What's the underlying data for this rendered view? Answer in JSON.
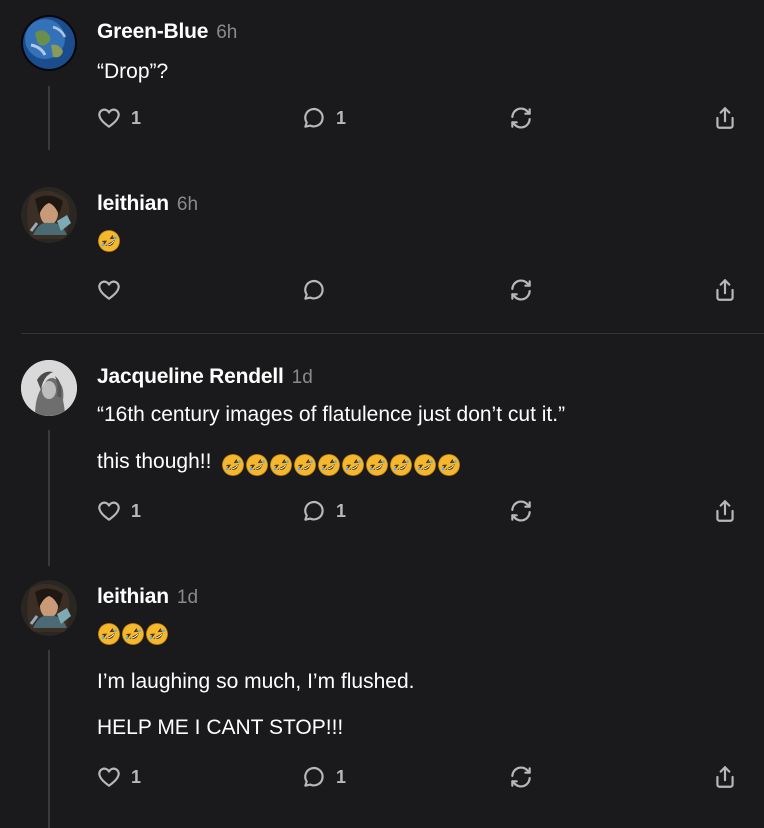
{
  "comments": [
    {
      "author": "Green-Blue",
      "time": "6h",
      "lines": [
        "“Drop”?"
      ],
      "likes": "1",
      "replies": "1"
    },
    {
      "author": "leithian",
      "time": "6h",
      "emoji_line": [
        "rolling-on-floor-laughing"
      ],
      "likes": "",
      "replies": ""
    },
    {
      "author": "Jacqueline Rendell",
      "time": "1d",
      "lines": [
        "“16th century images of flatulence just don’t cut it.”",
        "this though!!"
      ],
      "emoji_after_line_2": 10,
      "likes": "1",
      "replies": "1"
    },
    {
      "author": "leithian",
      "time": "1d",
      "emoji_line_count": 3,
      "lines": [
        "I’m laughing so much, I’m flushed.",
        "HELP ME I CANT STOP!!!"
      ],
      "likes": "1",
      "replies": "1"
    }
  ],
  "icons": {
    "like": "heart-icon",
    "reply": "comment-bubble-icon",
    "restack": "restack-icon",
    "share": "share-icon",
    "emoji": "rolling-on-floor-laughing-emoji"
  },
  "colors": {
    "background": "#1a1a1c",
    "text": "#ffffff",
    "muted": "#8a8a8e",
    "icon": "#b8b8bc",
    "thread_line": "#3a3a3d",
    "emoji_yellow": "#f5b72d"
  }
}
